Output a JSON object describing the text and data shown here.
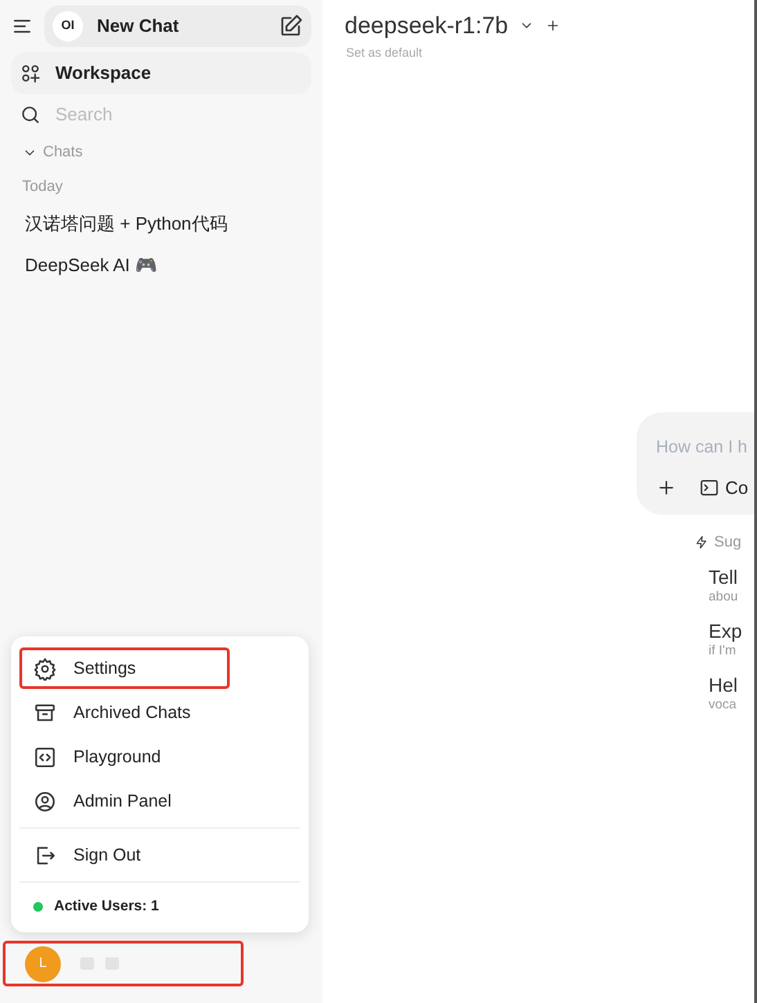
{
  "sidebar": {
    "logo": "OI",
    "new_chat": "New Chat",
    "workspace": "Workspace",
    "search": {
      "placeholder": "Search"
    },
    "chats_heading": "Chats",
    "chats_expanded": true,
    "groups": [
      {
        "label": "Today",
        "chats": [
          {
            "title": "汉诺塔问题 + Python代码"
          },
          {
            "title": "DeepSeek AI 🎮"
          }
        ]
      }
    ]
  },
  "user_menu": {
    "items": [
      {
        "label": "Settings",
        "highlighted": true,
        "separated": false
      },
      {
        "label": "Archived Chats",
        "highlighted": false,
        "separated": false
      },
      {
        "label": "Playground",
        "highlighted": false,
        "separated": false
      },
      {
        "label": "Admin Panel",
        "highlighted": false,
        "separated": false
      },
      {
        "label": "Sign Out",
        "highlighted": false,
        "separated": true
      }
    ],
    "active_users": "Active Users: 1",
    "online": true
  },
  "user": {
    "avatar": "L",
    "highlighted": true
  },
  "main": {
    "model": "deepseek-r1:7b",
    "set_default": "Set as default",
    "input": {
      "placeholder": "How can I h"
    },
    "tool": "Co",
    "suggested": "Sug",
    "suggestions": [
      {
        "title": "Tell",
        "subtitle": "abou"
      },
      {
        "title": "Exp",
        "subtitle": "if I'm"
      },
      {
        "title": "Hel",
        "subtitle": "voca"
      }
    ]
  }
}
